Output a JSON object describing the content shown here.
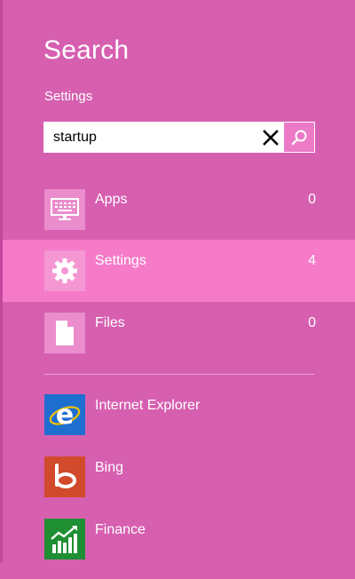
{
  "header": {
    "title": "Search",
    "scope": "Settings"
  },
  "search": {
    "value": "startup",
    "clear_icon": "close-icon",
    "submit_icon": "search-icon"
  },
  "scopes": [
    {
      "label": "Apps",
      "count": "0",
      "icon": "keyboard-icon",
      "selected": false
    },
    {
      "label": "Settings",
      "count": "4",
      "icon": "gear-icon",
      "selected": true
    },
    {
      "label": "Files",
      "count": "0",
      "icon": "file-icon",
      "selected": false
    }
  ],
  "apps": [
    {
      "label": "Internet Explorer",
      "icon": "internet-explorer-icon",
      "color": "#1f6fd1"
    },
    {
      "label": "Bing",
      "icon": "bing-icon",
      "color": "#d14a2c"
    },
    {
      "label": "Finance",
      "icon": "finance-icon",
      "color": "#1f8f33"
    }
  ],
  "colors": {
    "background": "#d65fb0",
    "selected_row": "#f57bc9",
    "search_button": "#ec7ac6"
  }
}
